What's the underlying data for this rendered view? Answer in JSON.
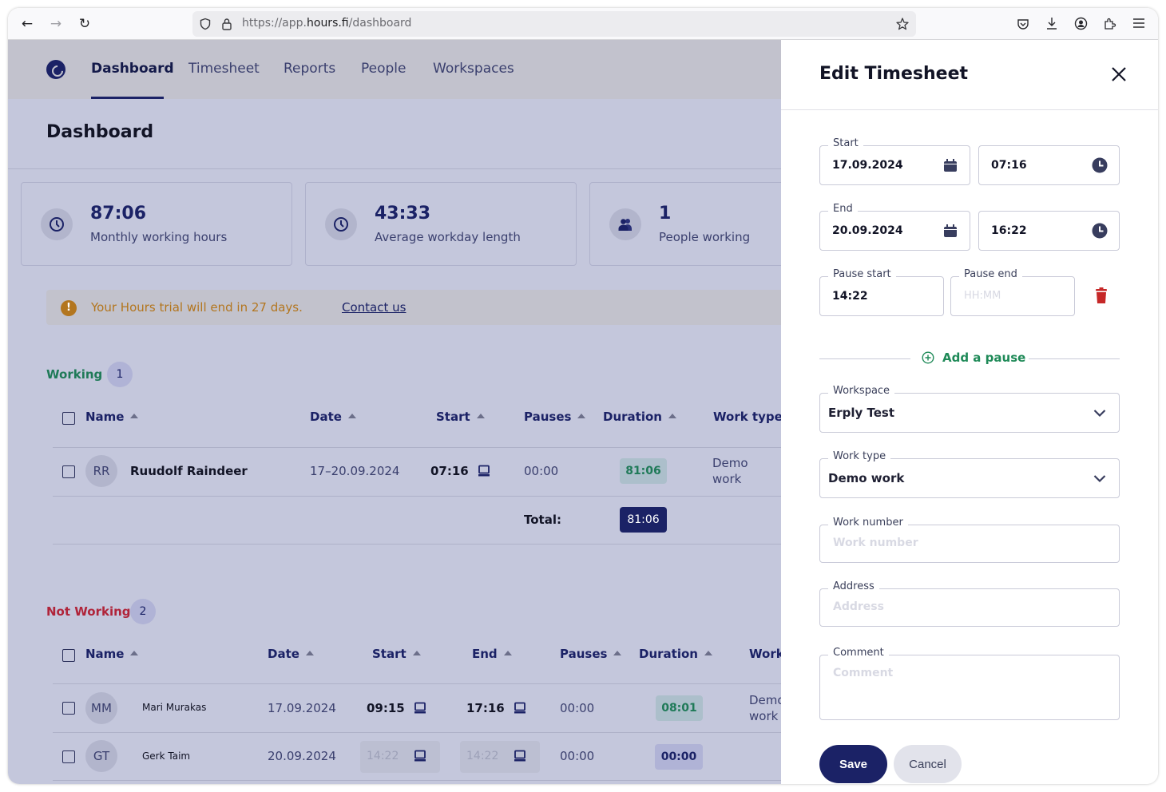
{
  "browser": {
    "url_prefix": "https://app.",
    "url_domain": "hours.fi",
    "url_path": "/dashboard"
  },
  "nav": {
    "items": [
      {
        "label": "Dashboard",
        "active": true
      },
      {
        "label": "Timesheet"
      },
      {
        "label": "Reports"
      },
      {
        "label": "People"
      },
      {
        "label": "Workspaces"
      }
    ]
  },
  "page": {
    "title": "Dashboard"
  },
  "stats": [
    {
      "value": "87:06",
      "label": "Monthly working hours",
      "icon": "clock-icon"
    },
    {
      "value": "43:33",
      "label": "Average workday length",
      "icon": "clock-icon"
    },
    {
      "value": "1",
      "label": "People working",
      "icon": "people-icon"
    }
  ],
  "trial": {
    "text": "Your Hours trial will end in 27 days.",
    "link": "Contact us"
  },
  "working": {
    "label": "Working",
    "count": "1",
    "color": "#1f7a58",
    "columns": [
      "Name",
      "Date",
      "Start",
      "Pauses",
      "Duration",
      "Work type"
    ],
    "rows": [
      {
        "initials": "RR",
        "name": "Ruudolf Raindeer",
        "date": "17–20.09.2024",
        "start": "07:16",
        "pauses": "00:00",
        "duration": "81:06",
        "work_type_1": "Demo",
        "work_type_2": "work"
      }
    ],
    "total_label": "Total:",
    "total": "81:06"
  },
  "not_working": {
    "label": "Not Working",
    "count": "2",
    "color": "#b0243a",
    "columns": [
      "Name",
      "Date",
      "Start",
      "End",
      "Pauses",
      "Duration",
      "Work"
    ],
    "rows": [
      {
        "initials": "MM",
        "name": "Mari Murakas",
        "date": "17.09.2024",
        "start": "09:15",
        "end": "17:16",
        "pauses": "00:00",
        "duration": "08:01",
        "work_type_1": "Demo",
        "work_type_2": "work"
      },
      {
        "initials": "GT",
        "name": "Gerk Taim",
        "date": "20.09.2024",
        "start": "14:22",
        "end": "14:22",
        "pauses": "00:00",
        "duration": "00:00"
      }
    ]
  },
  "drawer": {
    "title": "Edit Timesheet",
    "start_label": "Start",
    "start_date": "17.09.2024",
    "start_time": "07:16",
    "end_label": "End",
    "end_date": "20.09.2024",
    "end_time": "16:22",
    "pause_start_label": "Pause start",
    "pause_start": "14:22",
    "pause_end_label": "Pause end",
    "pause_end_placeholder": "HH:MM",
    "add_pause": "Add a pause",
    "workspace_label": "Workspace",
    "workspace": "Erply Test",
    "work_type_label": "Work type",
    "work_type": "Demo work",
    "work_number_label": "Work number",
    "work_number_placeholder": "Work number",
    "address_label": "Address",
    "address_placeholder": "Address",
    "comment_label": "Comment",
    "comment_placeholder": "Comment",
    "save": "Save",
    "cancel": "Cancel"
  }
}
